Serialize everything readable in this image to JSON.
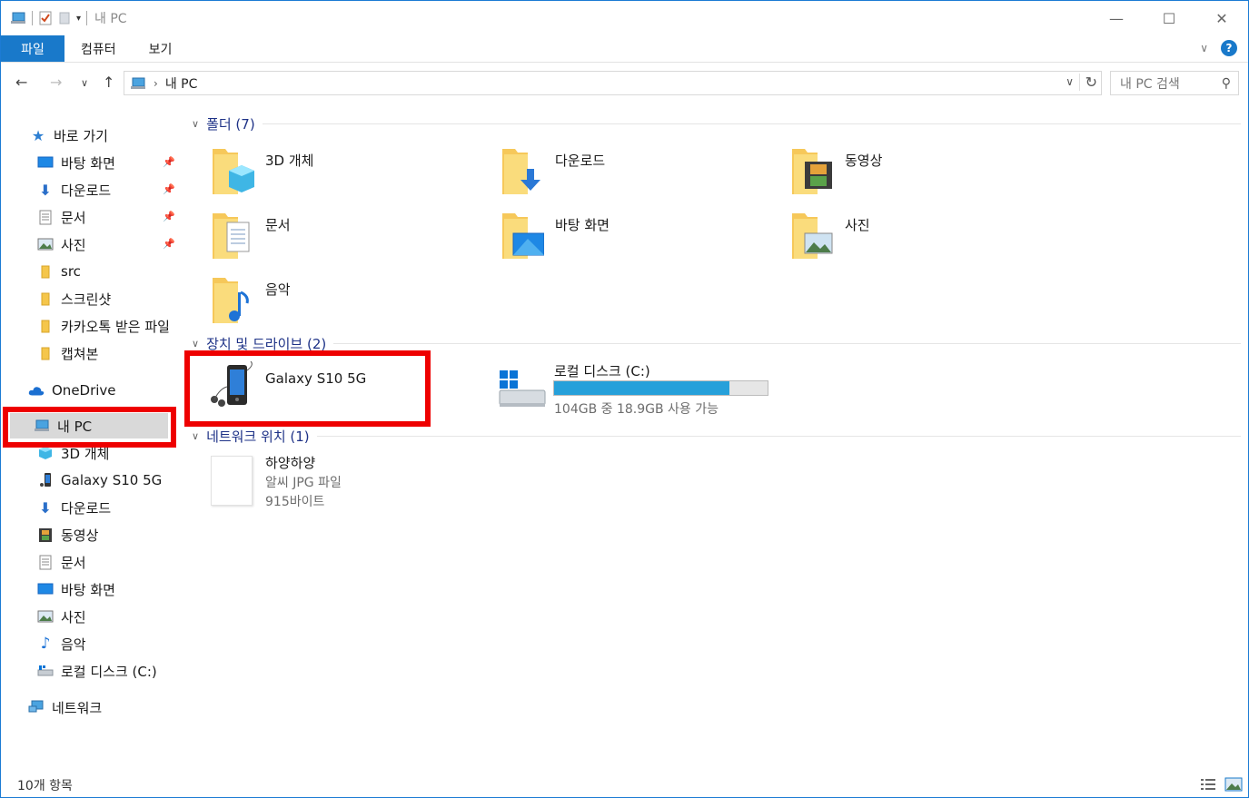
{
  "window": {
    "title": "내 PC"
  },
  "ribbon": {
    "tabs": [
      "파일",
      "컴퓨터",
      "보기"
    ]
  },
  "address": {
    "crumb": "내 PC",
    "search_placeholder": "내 PC 검색"
  },
  "nav": {
    "quick_access": "바로 가기",
    "quick_items": [
      "바탕 화면",
      "다운로드",
      "문서",
      "사진",
      "src",
      "스크린샷",
      "카카오톡 받은 파일",
      "캡쳐본"
    ],
    "onedrive": "OneDrive",
    "this_pc": "내 PC",
    "pc_items": [
      "3D 개체",
      "Galaxy S10 5G",
      "다운로드",
      "동영상",
      "문서",
      "바탕 화면",
      "사진",
      "음악",
      "로컬 디스크 (C:)"
    ],
    "network": "네트워크"
  },
  "content": {
    "folders_header": "폴더 (7)",
    "folders": [
      "3D 개체",
      "다운로드",
      "동영상",
      "문서",
      "바탕 화면",
      "사진",
      "음악"
    ],
    "devices_header": "장치 및 드라이브 (2)",
    "device_phone": "Galaxy S10 5G",
    "drive_label": "로컬 디스크 (C:)",
    "drive_free_text": "104GB 중 18.9GB 사용 가능",
    "drive_used_fraction": 0.82,
    "network_header": "네트워크 위치 (1)",
    "net_item": {
      "name": "하양하양",
      "type": "알씨 JPG 파일",
      "size": "915바이트"
    }
  },
  "status": {
    "count": "10개 항목"
  },
  "colors": {
    "accent": "#1979ca",
    "highlight": "#ee0000",
    "drive_bar": "#26a0da"
  }
}
